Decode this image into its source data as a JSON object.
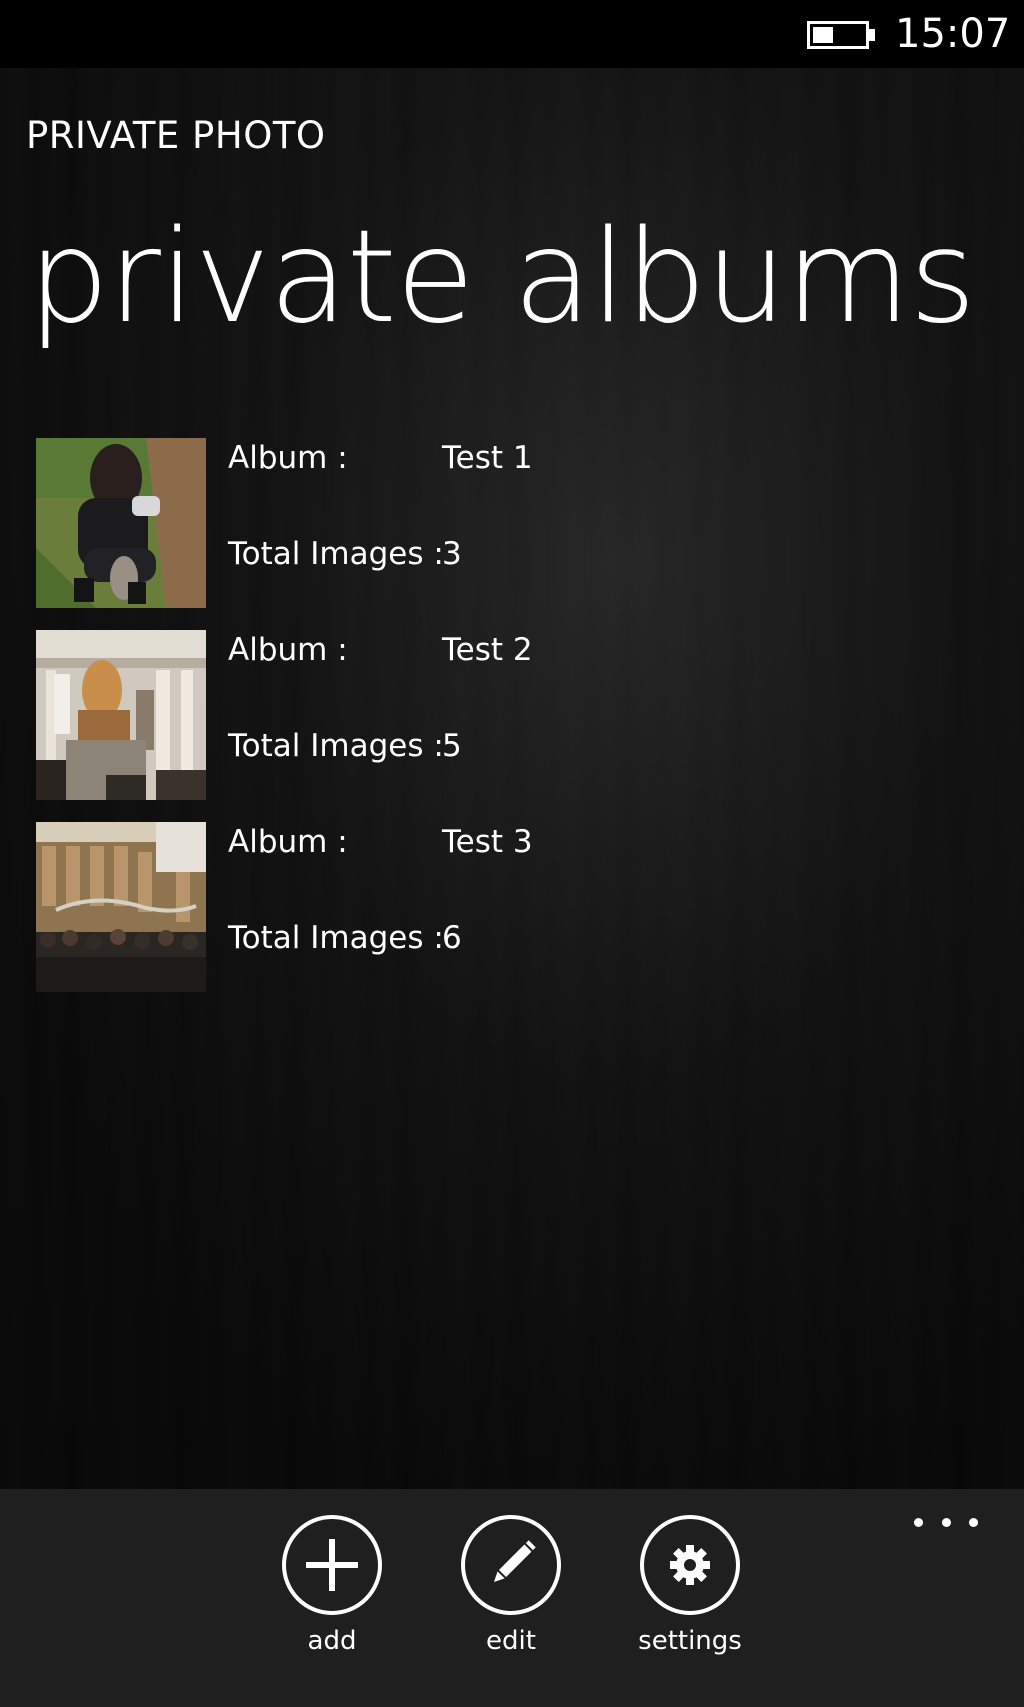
{
  "status_bar": {
    "time": "15:07",
    "battery_level": 0.4
  },
  "header": {
    "app_title": "PRIVATE PHOTO",
    "page_title": "private albums"
  },
  "albums": [
    {
      "album_label": "Album :",
      "album_name": "Test 1",
      "count_label": "Total Images :",
      "count_value": "3",
      "thumbnail": "person-crouching-with-cat-photo"
    },
    {
      "album_label": "Album :",
      "album_name": "Test 2",
      "count_label": "Total Images :",
      "count_value": "5",
      "thumbnail": "museum-statue-photo"
    },
    {
      "album_label": "Album :",
      "album_name": "Test 3",
      "count_label": "Total Images :",
      "count_value": "6",
      "thumbnail": "museum-hall-crowd-photo"
    }
  ],
  "app_bar": {
    "buttons": [
      {
        "label": "add",
        "icon": "plus-icon"
      },
      {
        "label": "edit",
        "icon": "pencil-icon"
      },
      {
        "label": "settings",
        "icon": "gear-icon"
      }
    ],
    "more_icon": "ellipsis-icon"
  }
}
